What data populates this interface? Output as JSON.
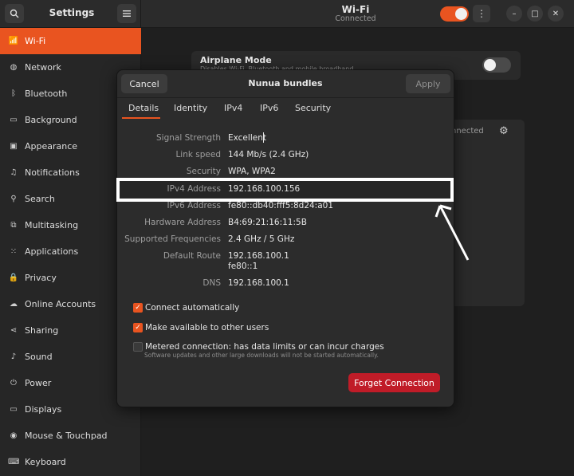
{
  "header": {
    "search_icon": "search-icon",
    "menu_icon": "hamburger-icon",
    "settings_title": "Settings",
    "panel_title": "Wi-Fi",
    "panel_subtitle": "Connected",
    "wifi_toggle_on": true,
    "accent": "#e95420"
  },
  "sidebar": {
    "items": [
      {
        "label": "Wi-Fi",
        "icon": "wifi-icon",
        "active": true
      },
      {
        "label": "Network",
        "icon": "network-icon"
      },
      {
        "label": "Bluetooth",
        "icon": "bluetooth-icon"
      },
      {
        "label": "Background",
        "icon": "background-icon"
      },
      {
        "label": "Appearance",
        "icon": "appearance-icon"
      },
      {
        "label": "Notifications",
        "icon": "bell-icon"
      },
      {
        "label": "Search",
        "icon": "search-icon"
      },
      {
        "label": "Multitasking",
        "icon": "multitasking-icon"
      },
      {
        "label": "Applications",
        "icon": "applications-icon"
      },
      {
        "label": "Privacy",
        "icon": "lock-icon"
      },
      {
        "label": "Online Accounts",
        "icon": "cloud-icon"
      },
      {
        "label": "Sharing",
        "icon": "share-icon"
      },
      {
        "label": "Sound",
        "icon": "music-icon"
      },
      {
        "label": "Power",
        "icon": "power-icon"
      },
      {
        "label": "Displays",
        "icon": "display-icon"
      },
      {
        "label": "Mouse & Touchpad",
        "icon": "mouse-icon"
      },
      {
        "label": "Keyboard",
        "icon": "keyboard-icon"
      }
    ]
  },
  "main": {
    "airplane_title": "Airplane Mode",
    "airplane_subtitle": "Disables Wi-Fi, Bluetooth and mobile broadband",
    "connected_text": "nnected"
  },
  "dialog": {
    "cancel_label": "Cancel",
    "title": "Nunua bundles",
    "apply_label": "Apply",
    "tabs": [
      "Details",
      "Identity",
      "IPv4",
      "IPv6",
      "Security"
    ],
    "details": {
      "signal_label": "Signal Strength",
      "signal_value": "Excellent",
      "link_label": "Link speed",
      "link_value": "144 Mb/s (2.4 GHz)",
      "security_label": "Security",
      "security_value": "WPA, WPA2",
      "ipv4_label": "IPv4 Address",
      "ipv4_value": "192.168.100.156",
      "ipv6_label": "IPv6 Address",
      "ipv6_value": "fe80::db40:fff5:8d24:a01",
      "hw_label": "Hardware Address",
      "hw_value": "B4:69:21:16:11:5B",
      "freq_label": "Supported Frequencies",
      "freq_value": "2.4 GHz / 5 GHz",
      "route_label": "Default Route",
      "route_value_1": "192.168.100.1",
      "route_value_2": "fe80::1",
      "dns_label": "DNS",
      "dns_value": "192.168.100.1"
    },
    "checks": {
      "auto_connect": "Connect automatically",
      "auto_connect_checked": true,
      "available_users": "Make available to other users",
      "available_users_checked": true,
      "metered": "Metered connection: has data limits or can incur charges",
      "metered_checked": false,
      "metered_sub": "Software updates and other large downloads will not be started automatically."
    },
    "forget_label": "Forget Connection",
    "destructive_color": "#c01c28"
  }
}
